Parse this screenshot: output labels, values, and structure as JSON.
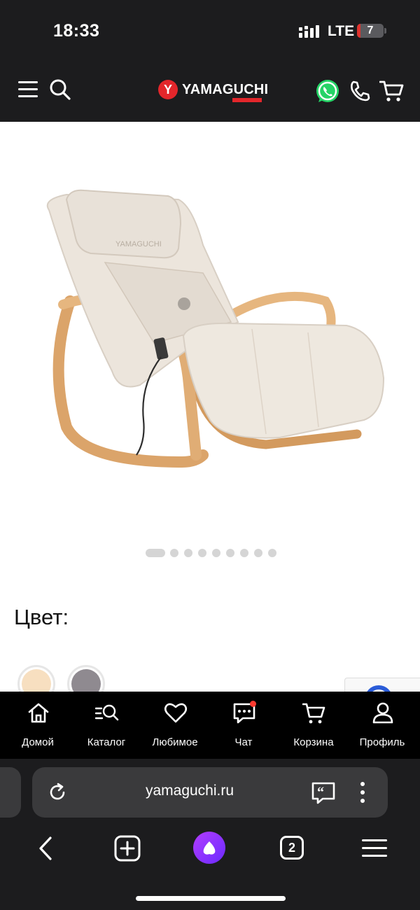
{
  "status_bar": {
    "time": "18:33",
    "network": "LTE",
    "battery": "7"
  },
  "header": {
    "brand": "YAMAGUCHI",
    "brand_mark": "Y",
    "icons": [
      "menu-icon",
      "search-icon",
      "whatsapp-icon",
      "phone-icon",
      "cart-icon"
    ]
  },
  "product": {
    "image": "rocking-massage-chair",
    "carousel": {
      "total": 10,
      "active": 1
    },
    "color_label": "Цвет:",
    "color_swatches": [
      {
        "name": "beige",
        "color": "#f7dfc0"
      },
      {
        "name": "grey",
        "color": "#8f8a90"
      }
    ]
  },
  "app_nav": {
    "items": [
      {
        "label": "Домой",
        "icon": "home-icon"
      },
      {
        "label": "Каталог",
        "icon": "catalog-search-icon"
      },
      {
        "label": "Любимое",
        "icon": "heart-icon"
      },
      {
        "label": "Чат",
        "icon": "chat-icon",
        "badge": true
      },
      {
        "label": "Корзина",
        "icon": "cart-icon"
      },
      {
        "label": "Профиль",
        "icon": "profile-icon"
      }
    ]
  },
  "browser": {
    "url": "yamaguchi.ru",
    "tab_count": "2"
  },
  "colors": {
    "header_bg": "#1c1c1e",
    "brand_red": "#e3262b",
    "whatsapp_green": "#25d366",
    "nav_bg": "#000000"
  }
}
